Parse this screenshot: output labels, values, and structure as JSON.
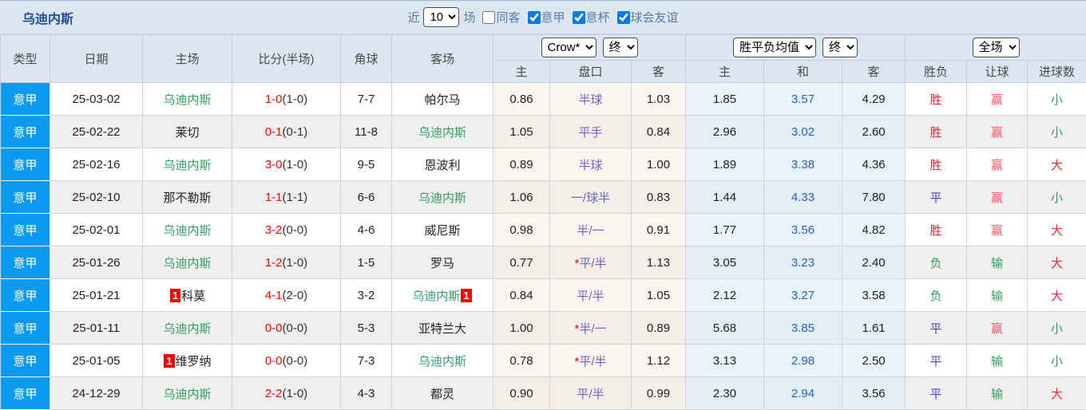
{
  "page": {
    "team_title": "乌迪内斯"
  },
  "topbar": {
    "recent_label": "近",
    "recent_value": "10",
    "matches_label": "场",
    "same_away": {
      "label": "同客",
      "checked": false
    },
    "filters": [
      {
        "label": "意甲",
        "checked": true
      },
      {
        "label": "意杯",
        "checked": true
      },
      {
        "label": "球会友谊",
        "checked": true
      }
    ]
  },
  "colors": {
    "accent_blue": "#0b99f2",
    "title_blue": "#1e4f96",
    "header_bg": "#dce6f1",
    "team_green": "#2f9e62",
    "score_red": "#ff0000",
    "handicap_purple": "#6a66c4",
    "avg_draw_blue": "#2a5fc4",
    "win_red": "#ff2233",
    "lose_green": "#2f9e5b",
    "draw_blue": "#4a44cc",
    "badge_red": "#ff0000"
  },
  "table": {
    "columns": {
      "type": "类型",
      "date": "日期",
      "home": "主场",
      "score": "比分(半场)",
      "corner": "角球",
      "away": "客场",
      "odds_home": "主",
      "odds_handicap": "盘口",
      "odds_away": "客",
      "avg_home": "主",
      "avg_draw": "和",
      "avg_away": "客",
      "result": "胜负",
      "handicap_result": "让球",
      "goals": "进球数"
    },
    "selects": {
      "bookmaker": "Crow*",
      "bookmaker_state": "终",
      "avg": "胜平负均值",
      "avg_state": "终",
      "scope": "全场"
    },
    "rows": [
      {
        "type": "意甲",
        "date": "25-03-02",
        "home": "乌迪内斯",
        "home_badge": "",
        "score_ft": "1-0",
        "score_ht": "(1-0)",
        "corner": "7-7",
        "away": "帕尔马",
        "away_badge": "",
        "odds": [
          "0.86",
          "半球",
          "1.03"
        ],
        "avg": [
          "1.85",
          "3.57",
          "4.29"
        ],
        "res": [
          "胜",
          "赢",
          "小"
        ]
      },
      {
        "type": "意甲",
        "date": "25-02-22",
        "home": "莱切",
        "home_badge": "",
        "score_ft": "0-1",
        "score_ht": "(0-1)",
        "corner": "11-8",
        "away": "乌迪内斯",
        "away_badge": "",
        "odds": [
          "1.05",
          "平手",
          "0.84"
        ],
        "avg": [
          "2.96",
          "3.02",
          "2.60"
        ],
        "res": [
          "胜",
          "赢",
          "小"
        ]
      },
      {
        "type": "意甲",
        "date": "25-02-16",
        "home": "乌迪内斯",
        "home_badge": "",
        "score_ft": "3-0",
        "score_ht": "(1-0)",
        "corner": "9-5",
        "away": "恩波利",
        "away_badge": "",
        "odds": [
          "0.89",
          "半球",
          "1.00"
        ],
        "avg": [
          "1.89",
          "3.38",
          "4.36"
        ],
        "res": [
          "胜",
          "赢",
          "大"
        ]
      },
      {
        "type": "意甲",
        "date": "25-02-10",
        "home": "那不勒斯",
        "home_badge": "",
        "score_ft": "1-1",
        "score_ht": "(1-1)",
        "corner": "6-6",
        "away": "乌迪内斯",
        "away_badge": "",
        "odds": [
          "1.06",
          "一/球半",
          "0.83"
        ],
        "avg": [
          "1.44",
          "4.33",
          "7.80"
        ],
        "res": [
          "平",
          "赢",
          "小"
        ]
      },
      {
        "type": "意甲",
        "date": "25-02-01",
        "home": "乌迪内斯",
        "home_badge": "",
        "score_ft": "3-2",
        "score_ht": "(0-0)",
        "corner": "4-6",
        "away": "威尼斯",
        "away_badge": "",
        "odds": [
          "0.98",
          "半/一",
          "0.91"
        ],
        "avg": [
          "1.77",
          "3.56",
          "4.82"
        ],
        "res": [
          "胜",
          "赢",
          "大"
        ]
      },
      {
        "type": "意甲",
        "date": "25-01-26",
        "home": "乌迪内斯",
        "home_badge": "",
        "score_ft": "1-2",
        "score_ht": "(1-0)",
        "corner": "1-5",
        "away": "罗马",
        "away_badge": "",
        "odds": [
          "0.77",
          "*平/半",
          "1.13"
        ],
        "avg": [
          "3.05",
          "3.23",
          "2.40"
        ],
        "res": [
          "负",
          "输",
          "大"
        ]
      },
      {
        "type": "意甲",
        "date": "25-01-21",
        "home": "科莫",
        "home_badge": "1",
        "score_ft": "4-1",
        "score_ht": "(2-0)",
        "corner": "3-2",
        "away": "乌迪内斯",
        "away_badge": "1",
        "odds": [
          "0.84",
          "平/半",
          "1.05"
        ],
        "avg": [
          "2.12",
          "3.27",
          "3.58"
        ],
        "res": [
          "负",
          "输",
          "大"
        ]
      },
      {
        "type": "意甲",
        "date": "25-01-11",
        "home": "乌迪内斯",
        "home_badge": "",
        "score_ft": "0-0",
        "score_ht": "(0-0)",
        "corner": "5-3",
        "away": "亚特兰大",
        "away_badge": "",
        "odds": [
          "1.00",
          "*半/一",
          "0.89"
        ],
        "avg": [
          "5.68",
          "3.85",
          "1.61"
        ],
        "res": [
          "平",
          "赢",
          "小"
        ]
      },
      {
        "type": "意甲",
        "date": "25-01-05",
        "home": "维罗纳",
        "home_badge": "1",
        "score_ft": "0-0",
        "score_ht": "(0-0)",
        "corner": "7-3",
        "away": "乌迪内斯",
        "away_badge": "",
        "odds": [
          "0.78",
          "*平/半",
          "1.12"
        ],
        "avg": [
          "3.13",
          "2.98",
          "2.50"
        ],
        "res": [
          "平",
          "输",
          "小"
        ]
      },
      {
        "type": "意甲",
        "date": "24-12-29",
        "home": "乌迪内斯",
        "home_badge": "",
        "score_ft": "2-2",
        "score_ht": "(1-0)",
        "corner": "4-3",
        "away": "都灵",
        "away_badge": "",
        "odds": [
          "0.90",
          "平/半",
          "0.99"
        ],
        "avg": [
          "2.30",
          "2.94",
          "3.56"
        ],
        "res": [
          "平",
          "输",
          "大"
        ]
      }
    ]
  }
}
